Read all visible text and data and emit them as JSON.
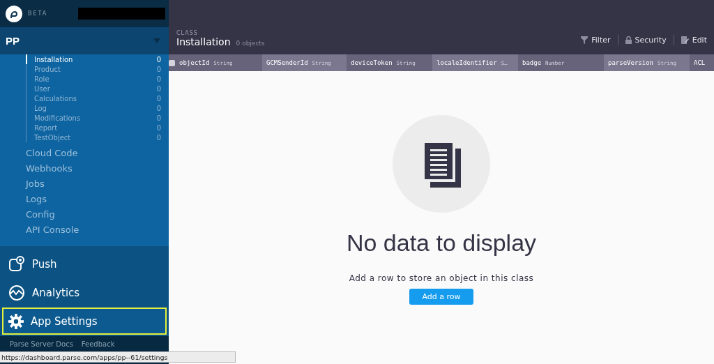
{
  "sidebar": {
    "badge": "BETA",
    "app_name": "PP",
    "classes": [
      {
        "name": "Installation",
        "count": "0",
        "selected": true
      },
      {
        "name": "Product",
        "count": "0",
        "selected": false
      },
      {
        "name": "Role",
        "count": "0",
        "selected": false
      },
      {
        "name": "User",
        "count": "0",
        "selected": false
      },
      {
        "name": "Calculations",
        "count": "0",
        "selected": false
      },
      {
        "name": "Log",
        "count": "0",
        "selected": false
      },
      {
        "name": "Modifications",
        "count": "0",
        "selected": false
      },
      {
        "name": "Report",
        "count": "0",
        "selected": false
      },
      {
        "name": "TestObject",
        "count": "0",
        "selected": false
      }
    ],
    "links": [
      "Cloud Code",
      "Webhooks",
      "Jobs",
      "Logs",
      "Config",
      "API Console"
    ],
    "sections": [
      {
        "kind": "push",
        "label": "Push",
        "selected": false
      },
      {
        "kind": "analytics",
        "label": "Analytics",
        "selected": false
      },
      {
        "kind": "settings",
        "label": "App Settings",
        "selected": true
      }
    ],
    "footer": [
      "Parse Server Docs",
      "Feedback"
    ]
  },
  "toolbar": {
    "section": "CLASS",
    "title": "Installation",
    "subtitle": "0 objects",
    "actions": [
      {
        "kind": "filter",
        "label": "Filter"
      },
      {
        "kind": "security",
        "label": "Security"
      },
      {
        "kind": "edit",
        "label": "Edit"
      }
    ]
  },
  "table": {
    "select_all": {
      "checked": false
    },
    "columns": [
      {
        "name": "objectId",
        "type": "String"
      },
      {
        "name": "GCMSenderId",
        "type": "String"
      },
      {
        "name": "deviceToken",
        "type": "String"
      },
      {
        "name": "localeIdentifier",
        "type": "S…"
      },
      {
        "name": "badge",
        "type": "Number"
      },
      {
        "name": "parseVersion",
        "type": "String"
      },
      {
        "name": "ACL"
      }
    ]
  },
  "empty_state": {
    "title": "No data to display",
    "message": "Add a row to store an object in this class",
    "button": "Add a row"
  },
  "status_url": "https://dashboard.parse.com/apps/pp--61/settings"
}
